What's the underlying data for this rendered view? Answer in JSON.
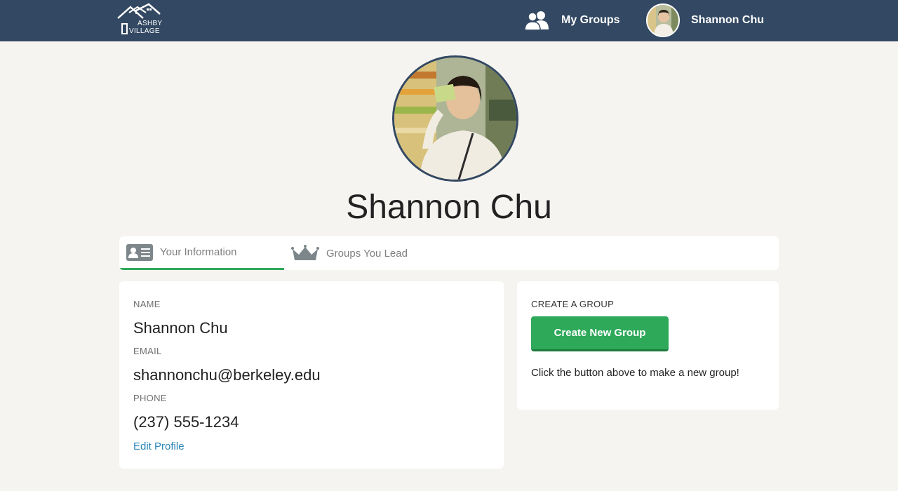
{
  "nav": {
    "logo_line1": "ASHBY",
    "logo_line2": "VILLAGE",
    "my_groups_label": "My Groups",
    "user_name": "Shannon Chu"
  },
  "profile": {
    "name": "Shannon Chu"
  },
  "tabs": [
    {
      "label": "Your Information",
      "icon": "contact-card-icon",
      "active": true
    },
    {
      "label": "Groups You Lead",
      "icon": "crown-icon",
      "active": false
    }
  ],
  "info": {
    "name_label": "NAME",
    "name_value": "Shannon Chu",
    "email_label": "EMAIL",
    "email_value": "shannonchu@berkeley.edu",
    "phone_label": "PHONE",
    "phone_value": "(237) 555-1234",
    "edit_link": "Edit Profile"
  },
  "create_group": {
    "title": "CREATE A GROUP",
    "button_label": "Create New Group",
    "hint": "Click the button above to make a new group!"
  },
  "colors": {
    "navbar": "#334862",
    "accent_green": "#2ea95a",
    "link_blue": "#2a86b8",
    "page_bg": "#f5f4f1"
  }
}
